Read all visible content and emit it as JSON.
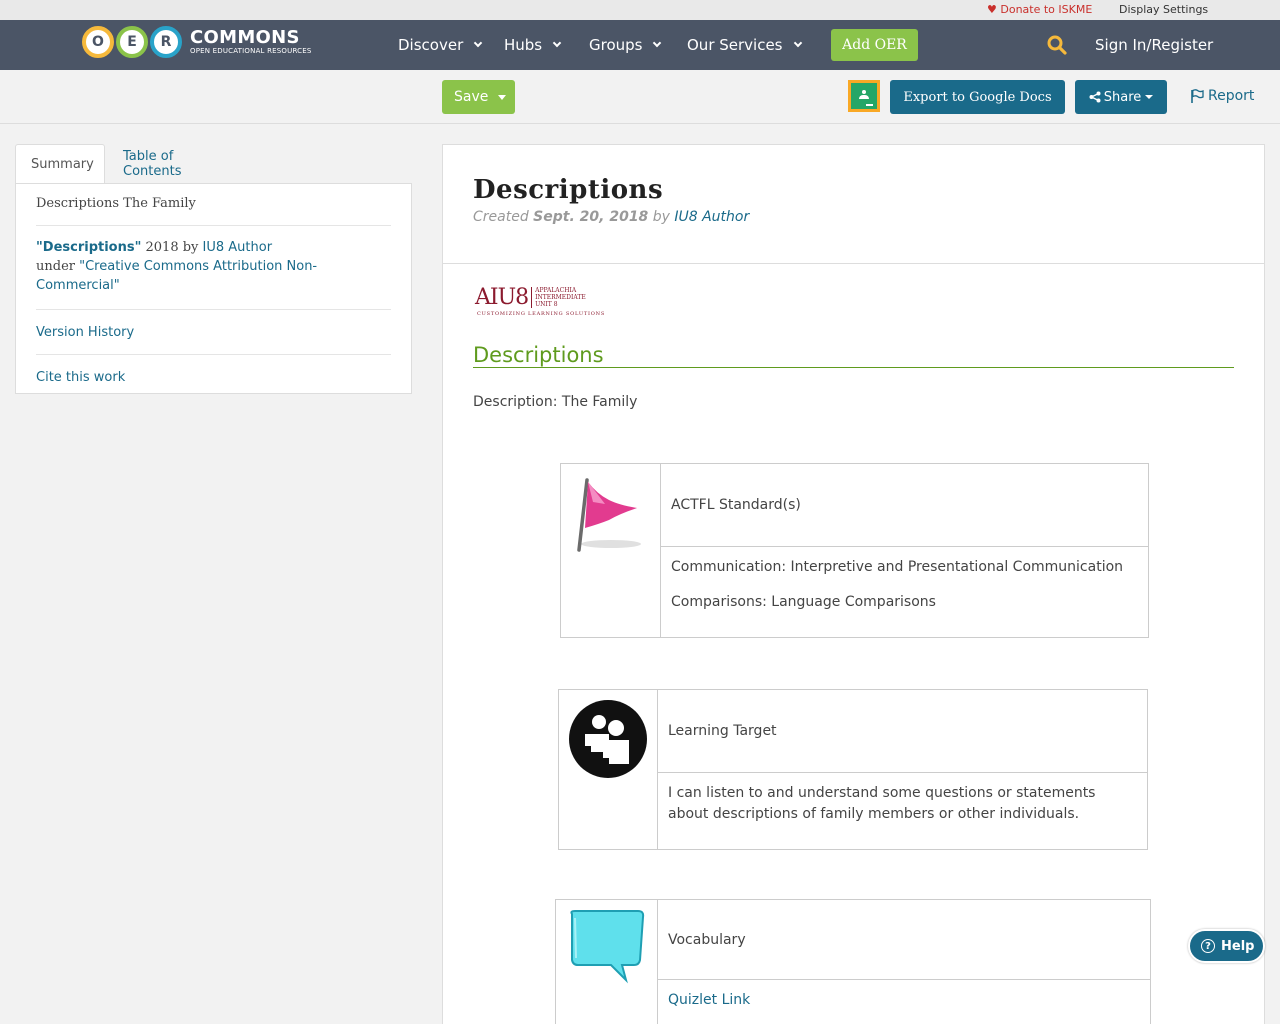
{
  "utility": {
    "donate": "Donate to ISKME",
    "display_settings": "Display Settings"
  },
  "nav": {
    "logo_letters": [
      "O",
      "E",
      "R"
    ],
    "logo_word": "COMMONS",
    "logo_sub": "OPEN EDUCATIONAL RESOURCES",
    "items": [
      "Discover",
      "Hubs",
      "Groups",
      "Our Services"
    ],
    "add_oer": "Add OER",
    "sign_in": "Sign In/Register"
  },
  "toolbar": {
    "save": "Save",
    "export": "Export to Google Docs",
    "share": "Share",
    "report": "Report"
  },
  "sidebar": {
    "tabs": [
      "Summary",
      "Table of Contents"
    ],
    "title": "Descriptions The Family",
    "license_title": "\"Descriptions\"",
    "license_year": " 2018 by ",
    "license_author": "IU8 Author",
    "license_under": "under ",
    "license_name": "\"Creative Commons Attribution Non-Commercial\"",
    "version_history": "Version History",
    "cite": "Cite this work"
  },
  "doc": {
    "title": "Descriptions",
    "created_label": "Created ",
    "created_date": "Sept. 20, 2018",
    "by_label": " by ",
    "author": "IU8 Author",
    "logo_big": "AIU8",
    "logo_sub": [
      "APPALACHIA",
      "INTERMEDIATE",
      "UNIT 8"
    ],
    "logo_tag": "CUSTOMIZING LEARNING SOLUTIONS",
    "section_heading": "Descriptions",
    "description": "Description: The Family",
    "tables": [
      {
        "icon": "flag-icon",
        "heading": "ACTFL Standard(s)",
        "lines": [
          "Communication: Interpretive and Presentational Communication",
          "Comparisons: Language Comparisons"
        ]
      },
      {
        "icon": "people-icon",
        "heading": "Learning Target",
        "lines": [
          "I can listen to and understand some questions or statements about descriptions of family members or other individuals."
        ]
      },
      {
        "icon": "speech-bubble-icon",
        "heading": "Vocabulary",
        "link": "Quizlet Link"
      }
    ]
  },
  "help": "Help",
  "colors": {
    "nav_bg": "#4b5566",
    "green": "#8bc34a",
    "teal": "#1a6a8a",
    "heading_green": "#5f9b1e"
  }
}
